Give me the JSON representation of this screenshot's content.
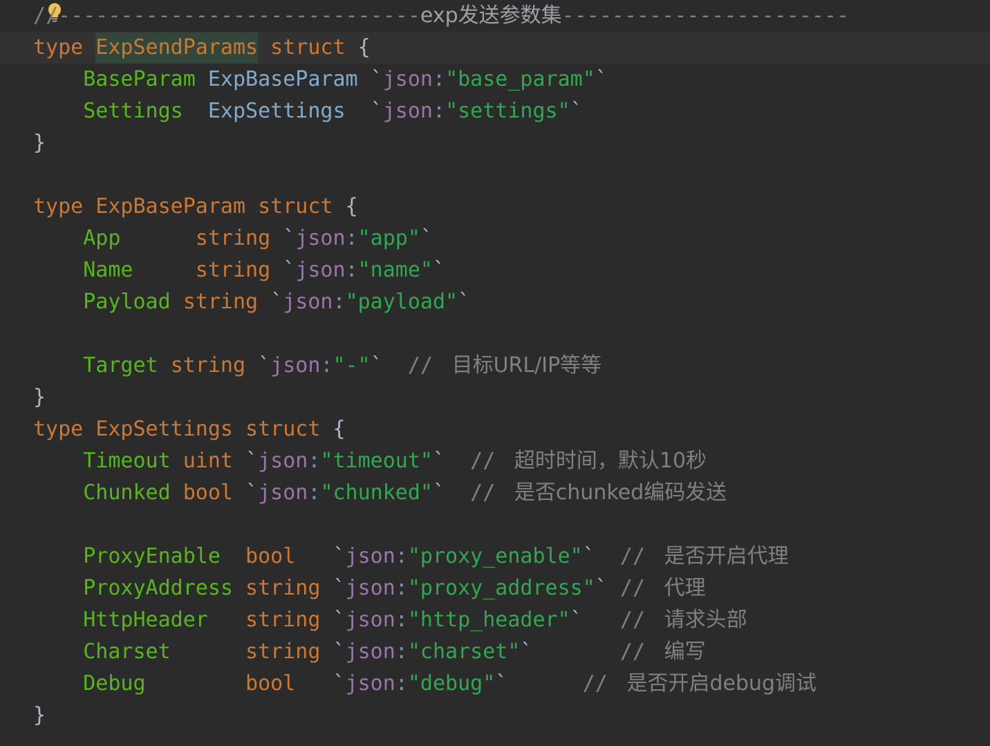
{
  "editor": {
    "language": "go",
    "theme": "darcula",
    "background_color": "#2b2b2b",
    "current_line_color": "#323232",
    "selection_color": "#32463a",
    "caret_color": "#bbbbbb"
  },
  "intention_icon": {
    "name": "lightbulb-icon",
    "color": "#f0c040"
  },
  "lines": [
    {
      "n": 1,
      "current": false,
      "segments": [
        {
          "cls": "cmt",
          "t": "/"
        },
        {
          "cls": "cmt",
          "t": "/"
        },
        {
          "cls": "ruler-line",
          "t": "-----------------------------"
        },
        {
          "cls": "ruler-cjk",
          "t": "exp发送参数集"
        },
        {
          "cls": "ruler-line",
          "t": "-----------------------"
        }
      ]
    },
    {
      "n": 2,
      "current": true,
      "segments": [
        {
          "cls": "kw",
          "t": "type "
        },
        {
          "cls": "caret",
          "t": ""
        },
        {
          "cls": "sel typname",
          "t": "ExpSendParams"
        },
        {
          "cls": "kw",
          "t": " struct "
        },
        {
          "cls": "brace",
          "t": "{"
        }
      ]
    },
    {
      "n": 3,
      "current": false,
      "segments": [
        {
          "cls": "field",
          "t": "    BaseParam "
        },
        {
          "cls": "ref",
          "t": "ExpBaseParam "
        },
        {
          "cls": "tick",
          "t": "`"
        },
        {
          "cls": "tagkey",
          "t": "json"
        },
        {
          "cls": "colon",
          "t": ":"
        },
        {
          "cls": "str",
          "t": "\"base_param\""
        },
        {
          "cls": "tick",
          "t": "`"
        }
      ]
    },
    {
      "n": 4,
      "current": false,
      "segments": [
        {
          "cls": "field",
          "t": "    Settings  "
        },
        {
          "cls": "ref",
          "t": "ExpSettings  "
        },
        {
          "cls": "tick",
          "t": "`"
        },
        {
          "cls": "tagkey",
          "t": "json"
        },
        {
          "cls": "colon",
          "t": ":"
        },
        {
          "cls": "str",
          "t": "\"settings\""
        },
        {
          "cls": "tick",
          "t": "`"
        }
      ]
    },
    {
      "n": 5,
      "current": false,
      "segments": [
        {
          "cls": "brace",
          "t": "}"
        }
      ]
    },
    {
      "n": 6,
      "current": false,
      "segments": []
    },
    {
      "n": 7,
      "current": false,
      "segments": [
        {
          "cls": "kw",
          "t": "type "
        },
        {
          "cls": "typname",
          "t": "ExpBaseParam"
        },
        {
          "cls": "kw",
          "t": " struct "
        },
        {
          "cls": "brace",
          "t": "{"
        }
      ]
    },
    {
      "n": 8,
      "current": false,
      "segments": [
        {
          "cls": "field",
          "t": "    App     "
        },
        {
          "cls": "btype",
          "t": " string "
        },
        {
          "cls": "tick",
          "t": "`"
        },
        {
          "cls": "tagkey",
          "t": "json"
        },
        {
          "cls": "colon",
          "t": ":"
        },
        {
          "cls": "str",
          "t": "\"app\""
        },
        {
          "cls": "tick",
          "t": "`"
        }
      ]
    },
    {
      "n": 9,
      "current": false,
      "segments": [
        {
          "cls": "field",
          "t": "    Name    "
        },
        {
          "cls": "btype",
          "t": " string "
        },
        {
          "cls": "tick",
          "t": "`"
        },
        {
          "cls": "tagkey",
          "t": "json"
        },
        {
          "cls": "colon",
          "t": ":"
        },
        {
          "cls": "str",
          "t": "\"name\""
        },
        {
          "cls": "tick",
          "t": "`"
        }
      ]
    },
    {
      "n": 10,
      "current": false,
      "segments": [
        {
          "cls": "field",
          "t": "    Payload "
        },
        {
          "cls": "btype",
          "t": "string "
        },
        {
          "cls": "tick",
          "t": "`"
        },
        {
          "cls": "tagkey",
          "t": "json"
        },
        {
          "cls": "colon",
          "t": ":"
        },
        {
          "cls": "str",
          "t": "\"payload\""
        },
        {
          "cls": "tick",
          "t": "`"
        }
      ]
    },
    {
      "n": 11,
      "current": false,
      "segments": []
    },
    {
      "n": 12,
      "current": false,
      "segments": [
        {
          "cls": "field",
          "t": "    Target "
        },
        {
          "cls": "btype",
          "t": "string "
        },
        {
          "cls": "tick",
          "t": "`"
        },
        {
          "cls": "tagkey",
          "t": "json"
        },
        {
          "cls": "colon",
          "t": ":"
        },
        {
          "cls": "str",
          "t": "\"-\""
        },
        {
          "cls": "tick",
          "t": "`"
        },
        {
          "cls": "cmt",
          "t": "  // "
        },
        {
          "cls": "cmt-cjk",
          "t": " 目标URL/IP等等"
        }
      ]
    },
    {
      "n": 13,
      "current": false,
      "segments": [
        {
          "cls": "brace",
          "t": "}"
        }
      ]
    },
    {
      "n": 14,
      "current": false,
      "segments": [
        {
          "cls": "kw",
          "t": "type "
        },
        {
          "cls": "typname",
          "t": "ExpSettings"
        },
        {
          "cls": "kw",
          "t": " struct "
        },
        {
          "cls": "brace",
          "t": "{"
        }
      ]
    },
    {
      "n": 15,
      "current": false,
      "segments": [
        {
          "cls": "field",
          "t": "    Timeout "
        },
        {
          "cls": "btype",
          "t": "uint "
        },
        {
          "cls": "tick",
          "t": "`"
        },
        {
          "cls": "tagkey",
          "t": "json"
        },
        {
          "cls": "colon",
          "t": ":"
        },
        {
          "cls": "str",
          "t": "\"timeout\""
        },
        {
          "cls": "tick",
          "t": "`"
        },
        {
          "cls": "cmt",
          "t": "  // "
        },
        {
          "cls": "cmt-cjk",
          "t": " 超时时间，默认10秒"
        }
      ]
    },
    {
      "n": 16,
      "current": false,
      "segments": [
        {
          "cls": "field",
          "t": "    Chunked "
        },
        {
          "cls": "btype",
          "t": "bool "
        },
        {
          "cls": "tick",
          "t": "`"
        },
        {
          "cls": "tagkey",
          "t": "json"
        },
        {
          "cls": "colon",
          "t": ":"
        },
        {
          "cls": "str",
          "t": "\"chunked\""
        },
        {
          "cls": "tick",
          "t": "`"
        },
        {
          "cls": "cmt",
          "t": "  // "
        },
        {
          "cls": "cmt-cjk",
          "t": " 是否chunked编码发送"
        }
      ]
    },
    {
      "n": 17,
      "current": false,
      "segments": []
    },
    {
      "n": 18,
      "current": false,
      "segments": [
        {
          "cls": "field",
          "t": "    ProxyEnable  "
        },
        {
          "cls": "btype",
          "t": "bool   "
        },
        {
          "cls": "tick",
          "t": "`"
        },
        {
          "cls": "tagkey",
          "t": "json"
        },
        {
          "cls": "colon",
          "t": ":"
        },
        {
          "cls": "str",
          "t": "\"proxy_enable\""
        },
        {
          "cls": "tick",
          "t": "`"
        },
        {
          "cls": "cmt",
          "t": "  // "
        },
        {
          "cls": "cmt-cjk",
          "t": " 是否开启代理"
        }
      ]
    },
    {
      "n": 19,
      "current": false,
      "segments": [
        {
          "cls": "field",
          "t": "    ProxyAddress "
        },
        {
          "cls": "btype",
          "t": "string "
        },
        {
          "cls": "tick",
          "t": "`"
        },
        {
          "cls": "tagkey",
          "t": "json"
        },
        {
          "cls": "colon",
          "t": ":"
        },
        {
          "cls": "str",
          "t": "\"proxy_address\""
        },
        {
          "cls": "tick",
          "t": "`"
        },
        {
          "cls": "cmt",
          "t": " // "
        },
        {
          "cls": "cmt-cjk",
          "t": " 代理"
        }
      ]
    },
    {
      "n": 20,
      "current": false,
      "segments": [
        {
          "cls": "field",
          "t": "    HttpHeader   "
        },
        {
          "cls": "btype",
          "t": "string "
        },
        {
          "cls": "tick",
          "t": "`"
        },
        {
          "cls": "tagkey",
          "t": "json"
        },
        {
          "cls": "colon",
          "t": ":"
        },
        {
          "cls": "str",
          "t": "\"http_header\""
        },
        {
          "cls": "tick",
          "t": "`"
        },
        {
          "cls": "cmt",
          "t": "   // "
        },
        {
          "cls": "cmt-cjk",
          "t": " 请求头部"
        }
      ]
    },
    {
      "n": 21,
      "current": false,
      "segments": [
        {
          "cls": "field",
          "t": "    Charset      "
        },
        {
          "cls": "btype",
          "t": "string "
        },
        {
          "cls": "tick",
          "t": "`"
        },
        {
          "cls": "tagkey",
          "t": "json"
        },
        {
          "cls": "colon",
          "t": ":"
        },
        {
          "cls": "str",
          "t": "\"charset\""
        },
        {
          "cls": "tick",
          "t": "`"
        },
        {
          "cls": "cmt",
          "t": "       // "
        },
        {
          "cls": "cmt-cjk",
          "t": " 编写"
        }
      ]
    },
    {
      "n": 22,
      "current": false,
      "segments": [
        {
          "cls": "field",
          "t": "    Debug        "
        },
        {
          "cls": "btype",
          "t": "bool   "
        },
        {
          "cls": "tick",
          "t": "`"
        },
        {
          "cls": "tagkey",
          "t": "json"
        },
        {
          "cls": "colon",
          "t": ":"
        },
        {
          "cls": "str",
          "t": "\"debug\""
        },
        {
          "cls": "tick",
          "t": "`"
        },
        {
          "cls": "cmt",
          "t": "      // "
        },
        {
          "cls": "cmt-cjk",
          "t": " 是否开启debug调试"
        }
      ]
    },
    {
      "n": 23,
      "current": false,
      "segments": [
        {
          "cls": "brace",
          "t": "}"
        }
      ]
    }
  ]
}
